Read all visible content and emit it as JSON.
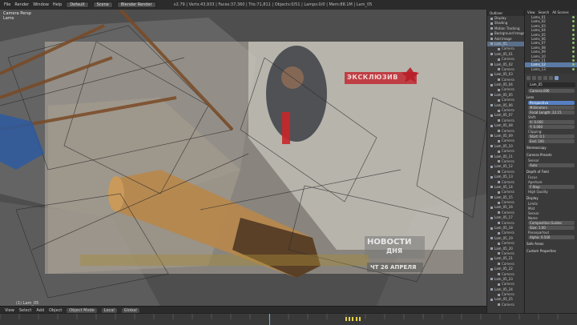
{
  "topbar": {
    "menus": [
      "File",
      "Render",
      "Window",
      "Help"
    ],
    "screen": "Default",
    "scene": "Scene",
    "engine": "Blender Render",
    "stats": "v2.79 | Verts:43,933 | Faces:37,360 | Tris:71,811 | Objects:0/51 | Lamps:0/0 | Mem:88.1M | Lam_05"
  },
  "viewport": {
    "overlay_title": "Camera Persp",
    "overlay_sub": "Lams",
    "object_name": "(1) Lam_05",
    "news_tag": "ЭКСКЛЮЗИВ",
    "news_logo_1": "НОВОСТИ",
    "news_logo_2": "ДНЯ",
    "news_date": "ЧТ 26 АПРЕЛЯ"
  },
  "bottombar": {
    "view": "View",
    "select": "Select",
    "add": "Add",
    "object": "Object",
    "mode": "Object Mode",
    "pivot": "Local",
    "global": "Global"
  },
  "outliner": {
    "header": "Outliner",
    "rows": [
      {
        "label": "Display",
        "cam": false
      },
      {
        "label": "Shading",
        "cam": false
      },
      {
        "label": "Motion Tracking",
        "cam": false
      },
      {
        "label": "Background Images",
        "cam": false
      },
      {
        "label": "Add Image",
        "cam": false
      },
      {
        "label": "Lam_05",
        "cam": false,
        "sel": true
      },
      {
        "label": "Camera",
        "cam": true
      },
      {
        "label": "Lam_05_01",
        "cam": false
      },
      {
        "label": "Camera",
        "cam": true
      },
      {
        "label": "Lam_05_02",
        "cam": false
      },
      {
        "label": "Camera",
        "cam": true
      },
      {
        "label": "Lam_05_03",
        "cam": false
      },
      {
        "label": "Camera",
        "cam": true
      },
      {
        "label": "Lam_05_04",
        "cam": false
      },
      {
        "label": "Camera",
        "cam": true
      },
      {
        "label": "Lam_05_05",
        "cam": false
      },
      {
        "label": "Camera",
        "cam": true
      },
      {
        "label": "Lam_05_06",
        "cam": false
      },
      {
        "label": "Camera",
        "cam": true
      },
      {
        "label": "Lam_05_07",
        "cam": false
      },
      {
        "label": "Camera",
        "cam": true
      },
      {
        "label": "Lam_05_08",
        "cam": false
      },
      {
        "label": "Camera",
        "cam": true
      },
      {
        "label": "Lam_05_09",
        "cam": false
      },
      {
        "label": "Camera",
        "cam": true
      },
      {
        "label": "Lam_05_10",
        "cam": false
      },
      {
        "label": "Camera",
        "cam": true
      },
      {
        "label": "Lam_05_11",
        "cam": false
      },
      {
        "label": "Camera",
        "cam": true
      },
      {
        "label": "Lam_05_12",
        "cam": false
      },
      {
        "label": "Camera",
        "cam": true
      },
      {
        "label": "Lam_05_13",
        "cam": false
      },
      {
        "label": "Camera",
        "cam": true
      },
      {
        "label": "Lam_05_14",
        "cam": false
      },
      {
        "label": "Camera",
        "cam": true
      },
      {
        "label": "Lam_05_15",
        "cam": false
      },
      {
        "label": "Camera",
        "cam": true
      },
      {
        "label": "Lam_05_16",
        "cam": false
      },
      {
        "label": "Camera",
        "cam": true
      },
      {
        "label": "Lam_05_17",
        "cam": false
      },
      {
        "label": "Camera",
        "cam": true
      },
      {
        "label": "Lam_05_18",
        "cam": false
      },
      {
        "label": "Camera",
        "cam": true
      },
      {
        "label": "Lam_05_19",
        "cam": false
      },
      {
        "label": "Camera",
        "cam": true
      },
      {
        "label": "Lam_05_20",
        "cam": false
      },
      {
        "label": "Camera",
        "cam": true
      },
      {
        "label": "Lam_05_21",
        "cam": false
      },
      {
        "label": "Camera",
        "cam": true
      },
      {
        "label": "Lam_05_22",
        "cam": false
      },
      {
        "label": "Camera",
        "cam": true
      },
      {
        "label": "Lam_05_23",
        "cam": false
      },
      {
        "label": "Camera",
        "cam": true
      },
      {
        "label": "Lam_05_24",
        "cam": false
      },
      {
        "label": "Camera",
        "cam": true
      },
      {
        "label": "Lam_05_25",
        "cam": false
      },
      {
        "label": "Camera",
        "cam": true
      }
    ]
  },
  "scene_list": {
    "tabs": [
      "View",
      "Search",
      "All Scenes"
    ],
    "rows": [
      {
        "label": "Lams_01"
      },
      {
        "label": "Lams_02"
      },
      {
        "label": "Lams_03"
      },
      {
        "label": "Lams_04"
      },
      {
        "label": "Lams_05"
      },
      {
        "label": "Lams_06"
      },
      {
        "label": "Lams_07"
      },
      {
        "label": "Lams_08"
      },
      {
        "label": "Lams_09"
      },
      {
        "label": "Lams_10"
      },
      {
        "label": "Lams_11"
      },
      {
        "label": "Lams_12",
        "sel": true
      },
      {
        "label": "Lams_13"
      }
    ]
  },
  "properties": {
    "object_name": "Lam_05",
    "camera_field": "Camera.006",
    "lens_section": "Lens",
    "lens_type": "Perspective",
    "lens_unit": "Millimeters",
    "focal": "Focal Length: 22.15",
    "shift_label": "Shift:",
    "shift_x": "X: 0.000",
    "shift_y": "Y: 0.000",
    "clip_label": "Clipping:",
    "clip_start": "Start: 0.1",
    "clip_end": "End: 100",
    "stereo_section": "Stereoscopy",
    "presets_section": "Camera Presets",
    "sensor": "Sensor",
    "sensor_auto": "Auto",
    "dof_section": "Depth of Field",
    "focus": "Focus",
    "aperture": "Aperture",
    "fstop": "F-Stop",
    "high_quality": "High Quality",
    "display_section": "Display",
    "limits": "Limits",
    "mist": "Mist",
    "sensor_disp": "Sensor",
    "name_disp": "Name",
    "composition": "Composition Guides",
    "center": "Center",
    "thirds": "Thirds",
    "size": "Size: 1.00",
    "passepartout": "Passepartout",
    "alpha": "Alpha: 0.500",
    "safe_areas": "Safe Areas",
    "custom_props": "Custom Properties"
  },
  "timeline": {
    "keyframes": [
      0.598,
      0.604,
      0.61,
      0.616,
      0.622
    ],
    "cursor": 0.467
  }
}
